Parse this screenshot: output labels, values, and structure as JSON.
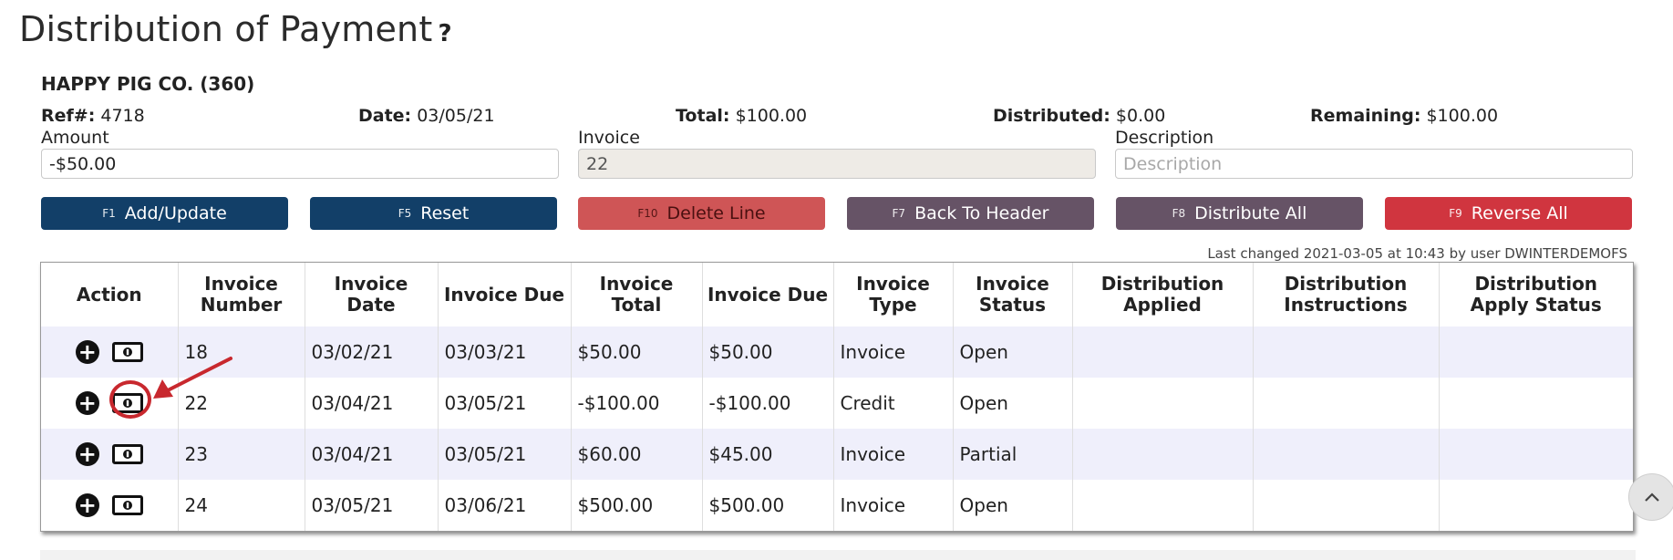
{
  "page": {
    "title": "Distribution of Payment",
    "help_glyph": "?"
  },
  "company": "HAPPY PIG CO. (360)",
  "summary": {
    "ref_label": "Ref#:",
    "ref_value": "4718",
    "date_label": "Date:",
    "date_value": "03/05/21",
    "total_label": "Total:",
    "total_value": "$100.00",
    "distributed_label": "Distributed:",
    "distributed_value": "$0.00",
    "remaining_label": "Remaining:",
    "remaining_value": "$100.00"
  },
  "form": {
    "amount_label": "Amount",
    "amount_value": "-$50.00",
    "invoice_label": "Invoice",
    "invoice_value": "22",
    "description_label": "Description",
    "description_placeholder": "Description",
    "description_value": ""
  },
  "buttons": [
    {
      "key": "F1",
      "label": "Add/Update",
      "color": "#123f68"
    },
    {
      "key": "F5",
      "label": "Reset",
      "color": "#123f68"
    },
    {
      "key": "F10",
      "label": "Delete Line",
      "color": "#cf5556"
    },
    {
      "key": "F7",
      "label": "Back To Header",
      "color": "#665366"
    },
    {
      "key": "F8",
      "label": "Distribute All",
      "color": "#665366"
    },
    {
      "key": "F9",
      "label": "Reverse All",
      "color": "#d0353f"
    }
  ],
  "last_changed": "Last changed 2021-03-05 at 10:43 by user DWINTERDEMOFS",
  "table": {
    "headers": [
      "Action",
      "Invoice Number",
      "Invoice Date",
      "Invoice Due",
      "Invoice Total",
      "Invoice Due",
      "Invoice Type",
      "Invoice Status",
      "Distribution Applied",
      "Distribution Instructions",
      "Distribution Apply Status"
    ],
    "rows": [
      {
        "number": "18",
        "date": "03/02/21",
        "due": "03/03/21",
        "total": "$50.00",
        "amount_due": "$50.00",
        "type": "Invoice",
        "status": "Open",
        "applied": "",
        "instructions": "",
        "apply_status": ""
      },
      {
        "number": "22",
        "date": "03/04/21",
        "due": "03/05/21",
        "total": "-$100.00",
        "amount_due": "-$100.00",
        "type": "Credit",
        "status": "Open",
        "applied": "",
        "instructions": "",
        "apply_status": ""
      },
      {
        "number": "23",
        "date": "03/04/21",
        "due": "03/05/21",
        "total": "$60.00",
        "amount_due": "$45.00",
        "type": "Invoice",
        "status": "Partial",
        "applied": "",
        "instructions": "",
        "apply_status": ""
      },
      {
        "number": "24",
        "date": "03/05/21",
        "due": "03/06/21",
        "total": "$500.00",
        "amount_due": "$500.00",
        "type": "Invoice",
        "status": "Open",
        "applied": "",
        "instructions": "",
        "apply_status": ""
      }
    ],
    "row_icons": [
      "plus-circle-icon",
      "money-bill-icon"
    ]
  },
  "annotation": {
    "highlight_row": 1,
    "color": "#c8282e"
  },
  "colors": {
    "row_alt": "#efeffb",
    "navy": "#123f68",
    "mauve": "#665366",
    "red": "#d0353f",
    "salmon": "#cf5556"
  }
}
